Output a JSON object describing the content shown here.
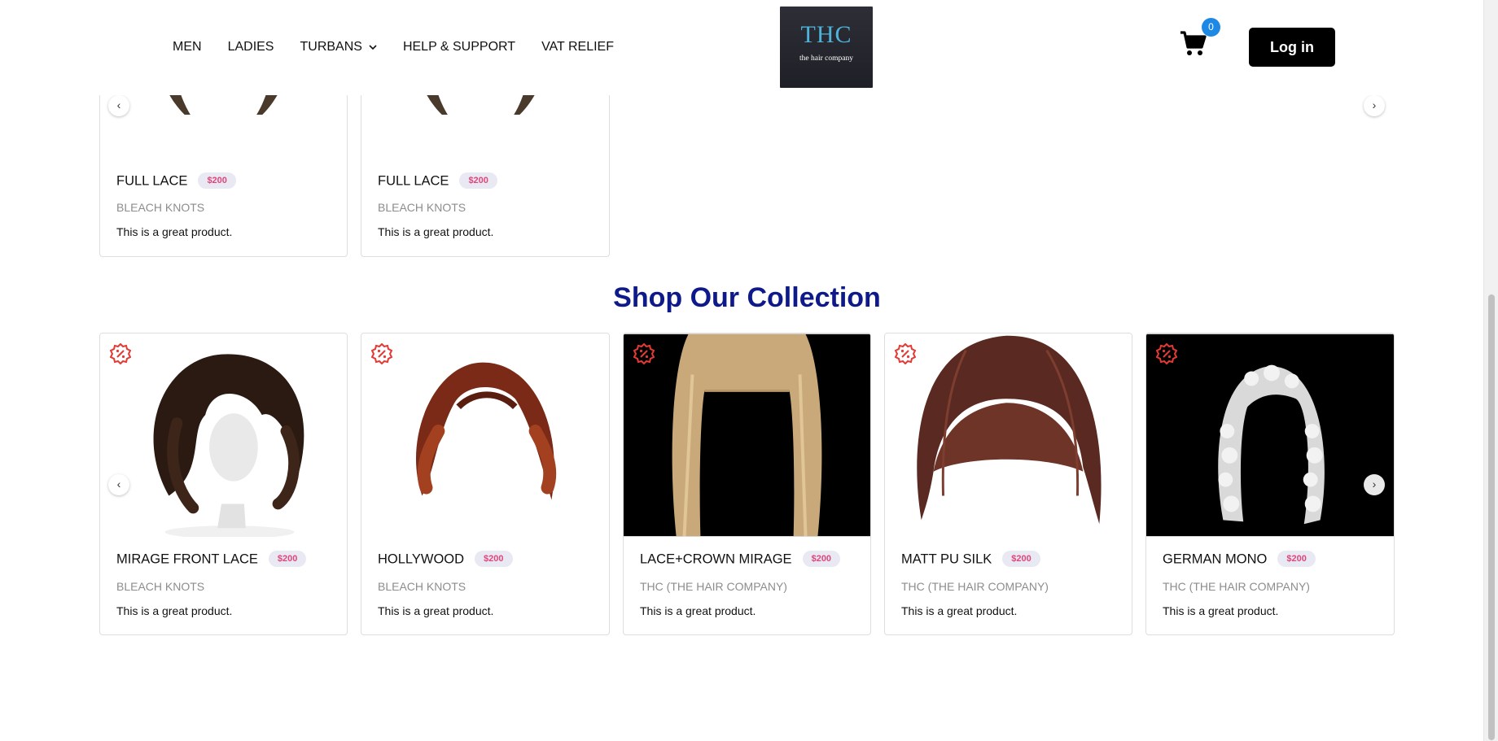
{
  "header": {
    "nav": [
      {
        "label": "MEN"
      },
      {
        "label": "LADIES"
      },
      {
        "label": "TURBANS",
        "has_dropdown": true
      },
      {
        "label": "HELP & SUPPORT"
      },
      {
        "label": "VAT RELIEF"
      }
    ],
    "logo": {
      "monogram": "THC",
      "brand": "the hair company"
    },
    "cart_count": "0",
    "login_label": "Log in"
  },
  "top_row": {
    "cards": [
      {
        "name": "FULL LACE",
        "price": "$200",
        "brand": "BLEACH KNOTS",
        "description": "This is a great product."
      },
      {
        "name": "FULL LACE",
        "price": "$200",
        "brand": "BLEACH KNOTS",
        "description": "This is a great product."
      }
    ]
  },
  "collection": {
    "title": "Shop Our Collection",
    "cards": [
      {
        "name": "MIRAGE FRONT LACE",
        "price": "$200",
        "brand": "BLEACH KNOTS",
        "description": "This is a great product."
      },
      {
        "name": "HOLLYWOOD",
        "price": "$200",
        "brand": "BLEACH KNOTS",
        "description": "This is a great product."
      },
      {
        "name": "LACE+CROWN MIRAGE",
        "price": "$200",
        "brand": "THC (THE HAIR COMPANY)",
        "description": "This is a great product."
      },
      {
        "name": "MATT PU SILK",
        "price": "$200",
        "brand": "THC (THE HAIR COMPANY)",
        "description": "This is a great product."
      },
      {
        "name": "GERMAN MONO",
        "price": "$200",
        "brand": "THC (THE HAIR COMPANY)",
        "description": "This is a great product."
      }
    ]
  },
  "icons": {
    "discount": "discount-badge-icon",
    "cart": "cart-icon",
    "prev": "chevron-left-icon",
    "next": "chevron-right-icon"
  },
  "colors": {
    "title": "#0f1a8a",
    "price_text": "#e0457b",
    "price_bg": "#e8e9f3",
    "discount_icon": "#e53935",
    "badge": "#1e88e5"
  }
}
